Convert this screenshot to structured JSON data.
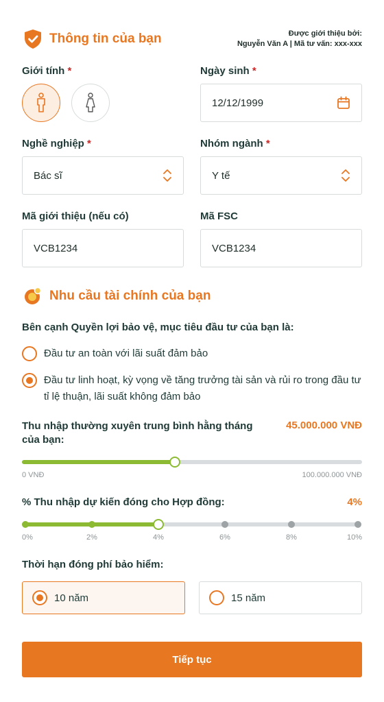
{
  "personal": {
    "title": "Thông tin của bạn",
    "referral_label": "Được giới thiệu bởi:",
    "referral_value": "Nguyễn Văn A | Mã tư vấn: xxx-xxx",
    "gender_label": "Giới tính",
    "gender_selected": "male",
    "dob_label": "Ngày sinh",
    "dob_value": "12/12/1999",
    "occupation_label": "Nghề nghiệp",
    "occupation_value": "Bác sĩ",
    "industry_label": "Nhóm ngành",
    "industry_value": "Y tế",
    "referral_code_label": "Mã giới thiệu (nếu có)",
    "referral_code_value": "VCB1234",
    "fsc_label": "Mã FSC",
    "fsc_value": "VCB1234",
    "required_mark": "*"
  },
  "needs": {
    "title": "Nhu cầu tài chính của bạn",
    "question": "Bên cạnh Quyền lợi bảo vệ, mục tiêu đầu tư của bạn là:",
    "options": [
      {
        "label": "Đầu tư an toàn với lãi suất đảm bảo",
        "checked": false
      },
      {
        "label": "Đầu tư linh hoạt, kỳ vọng về tăng trưởng tài sản và rủi ro trong đầu tư tỉ lệ thuận, lãi suất không đảm bảo",
        "checked": true
      }
    ],
    "income_label": "Thu nhập thường xuyên trung bình hằng tháng của bạn:",
    "income_value": "45.000.000 VNĐ",
    "income_min": "0 VNĐ",
    "income_max": "100.000.000 VNĐ",
    "income_fraction": 0.45,
    "percent_label": "% Thu nhập dự kiến đóng cho Hợp đồng:",
    "percent_value": "4%",
    "percent_steps": [
      "0%",
      "2%",
      "4%",
      "6%",
      "8%",
      "10%"
    ],
    "percent_selected_index": 2,
    "term_label": "Thời hạn đóng phí bảo hiểm:",
    "terms": [
      {
        "label": "10 năm",
        "checked": true
      },
      {
        "label": "15 năm",
        "checked": false
      }
    ]
  },
  "cta": {
    "label": "Tiếp tục"
  },
  "colors": {
    "accent": "#e87722",
    "slider": "#8cbb33",
    "required": "#c62828"
  }
}
